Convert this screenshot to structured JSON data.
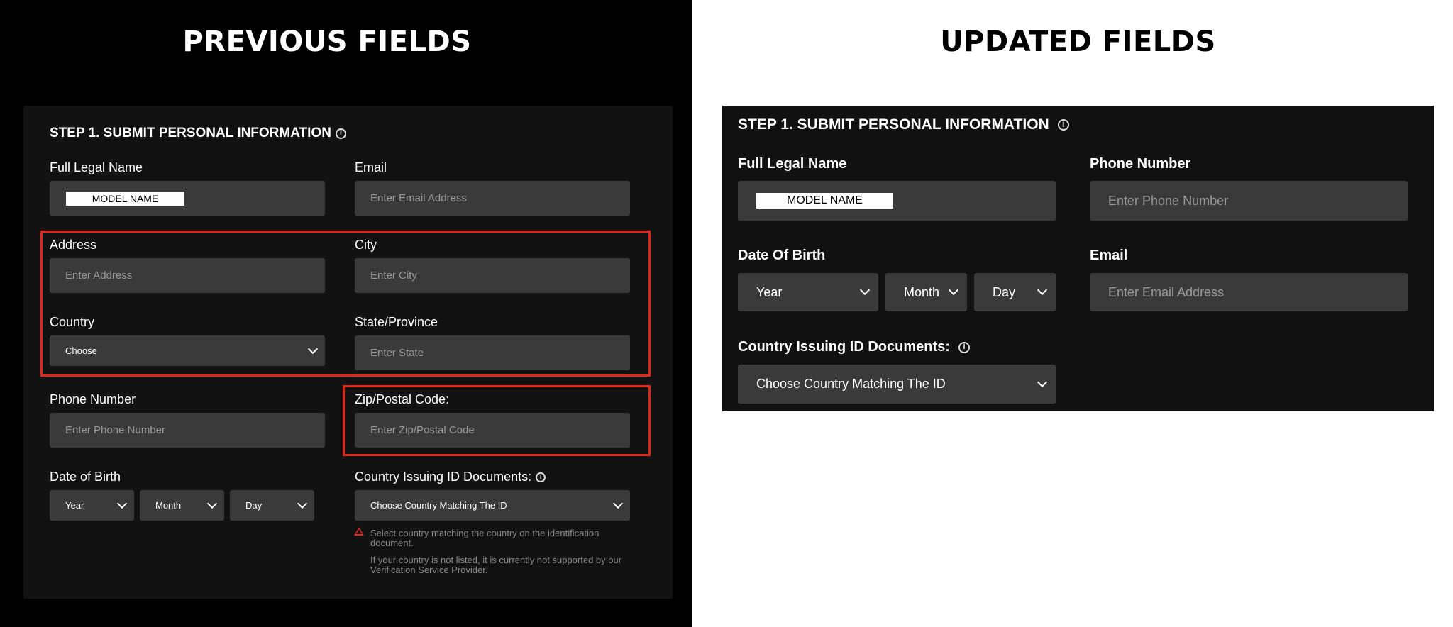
{
  "previous": {
    "heading": "PREVIOUS FIELDS",
    "step_title": "STEP 1. SUBMIT PERSONAL INFORMATION",
    "info_glyph": "i",
    "full_name": {
      "label": "Full Legal Name",
      "value": "MODEL NAME"
    },
    "email": {
      "label": "Email",
      "placeholder": "Enter Email Address"
    },
    "address": {
      "label": "Address",
      "placeholder": "Enter Address"
    },
    "city": {
      "label": "City",
      "placeholder": "Enter City"
    },
    "country": {
      "label": "Country",
      "value": "Choose"
    },
    "state": {
      "label": "State/Province",
      "placeholder": "Enter State"
    },
    "phone": {
      "label": "Phone Number",
      "placeholder": "Enter Phone Number"
    },
    "zip": {
      "label": "Zip/Postal Code:",
      "placeholder": "Enter Zip/Postal Code"
    },
    "dob": {
      "label": "Date of Birth",
      "year": "Year",
      "month": "Month",
      "day": "Day"
    },
    "id_country": {
      "label": "Country Issuing ID Documents:",
      "value": "Choose Country Matching The ID",
      "help1": "Select country matching the country on the identification document.",
      "help2": "If your country is not listed, it is currently not supported by our Verification Service Provider."
    },
    "highlight_color": "#e0271a"
  },
  "updated": {
    "heading": "UPDATED FIELDS",
    "step_title": "STEP 1. SUBMIT PERSONAL INFORMATION",
    "info_glyph": "i",
    "full_name": {
      "label": "Full Legal Name",
      "value": "MODEL NAME"
    },
    "phone": {
      "label": "Phone Number",
      "placeholder": "Enter Phone Number"
    },
    "dob": {
      "label": "Date Of Birth",
      "year": "Year",
      "month": "Month",
      "day": "Day"
    },
    "email": {
      "label": "Email",
      "placeholder": "Enter Email Address"
    },
    "id_country": {
      "label": "Country Issuing ID Documents:",
      "value": "Choose Country Matching The ID"
    }
  }
}
